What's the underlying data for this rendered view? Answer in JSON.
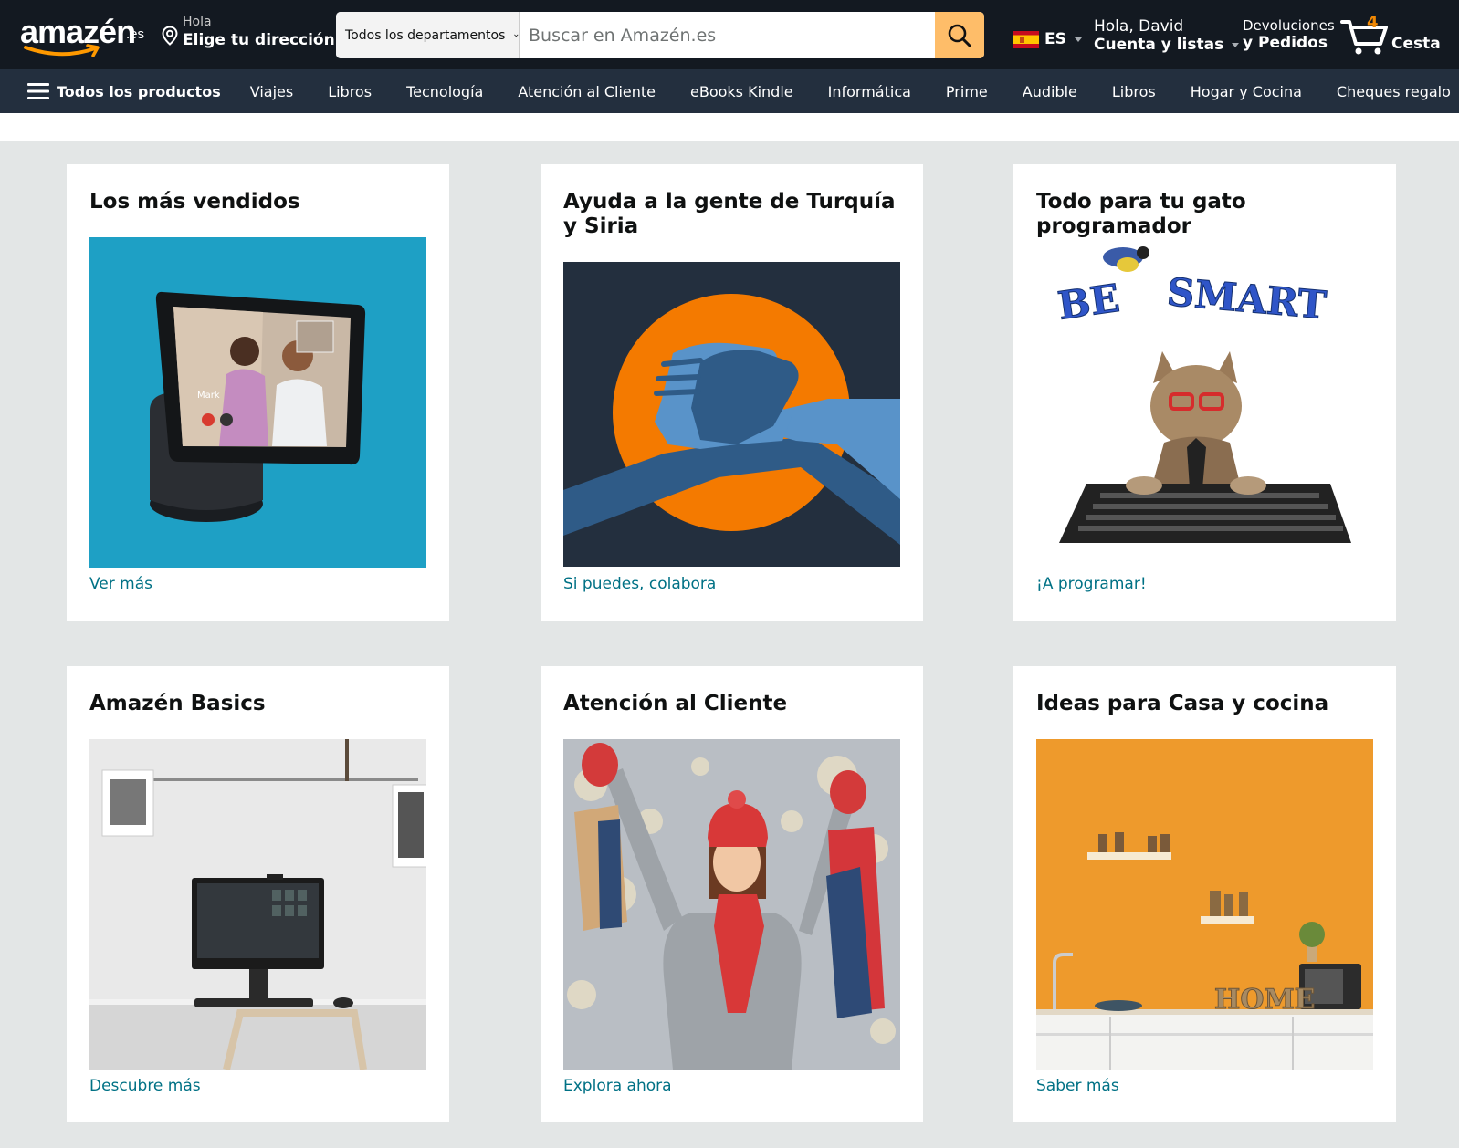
{
  "header": {
    "logo_text": "amazén",
    "logo_tld": ".es",
    "address_hello": "Hola",
    "address_choose": "Elige tu dirección",
    "search_department": "Todos los departamentos",
    "search_placeholder": "Buscar en Amazén.es",
    "language_code": "ES",
    "account_greeting": "Hola, David",
    "account_lists": "Cuenta y listas",
    "returns_label": "Devoluciones",
    "orders_label": "y Pedidos",
    "cart_count": "4",
    "cart_label": "Cesta"
  },
  "nav": {
    "all_label": "Todos los productos",
    "items": [
      "Viajes",
      "Libros",
      "Tecnología",
      "Atención al Cliente",
      "eBooks Kindle",
      "Informática",
      "Prime",
      "Audible",
      "Libros",
      "Hogar y Cocina",
      "Cheques regalo"
    ]
  },
  "cards": [
    {
      "title": "Los más vendidos",
      "link": "Ver más",
      "image_label": "Mark"
    },
    {
      "title": "Ayuda a la gente de Turquía y Siria",
      "link": "Si puedes, colabora"
    },
    {
      "title": "Todo para tu gato programador",
      "link": "¡A programar!",
      "image_text_1": "BE",
      "image_text_2": "SMART"
    },
    {
      "title": "Amazén Basics",
      "link": "Descubre más"
    },
    {
      "title": "Atención al Cliente",
      "link": "Explora ahora"
    },
    {
      "title": "Ideas para Casa y cocina",
      "link": "Saber más",
      "image_text": "HOME"
    }
  ],
  "colors": {
    "header_bg": "#131921",
    "nav_bg": "#232f3e",
    "search_button": "#febd69",
    "link": "#007185",
    "cart_count": "#f08804",
    "page_bg": "#e3e6e6"
  },
  "icons": [
    "location-pin-icon",
    "search-icon",
    "spain-flag-icon",
    "cart-icon",
    "hamburger-menu-icon",
    "chevron-down-icon"
  ]
}
